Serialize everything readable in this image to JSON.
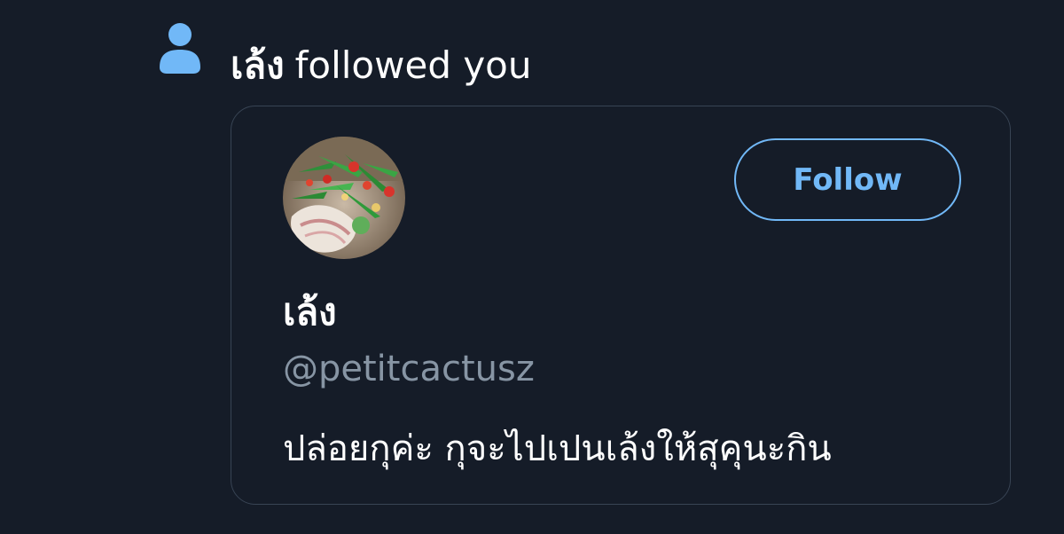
{
  "notification": {
    "icon": "person-icon",
    "actor_name": "เล้ง",
    "action_text": "followed you"
  },
  "profile_card": {
    "avatar": "food-photo-avatar",
    "follow_label": "Follow",
    "display_name": "เล้ง",
    "handle": "@petitcactusz",
    "bio": "ปล่อยกุค่ะ กุจะไปเปนเล้งให้สุคุนะกิน"
  },
  "colors": {
    "background": "#151c28",
    "accent": "#71b8f7",
    "card_border": "#384454",
    "secondary_text": "#8795a4",
    "primary_text": "#ffffff"
  }
}
